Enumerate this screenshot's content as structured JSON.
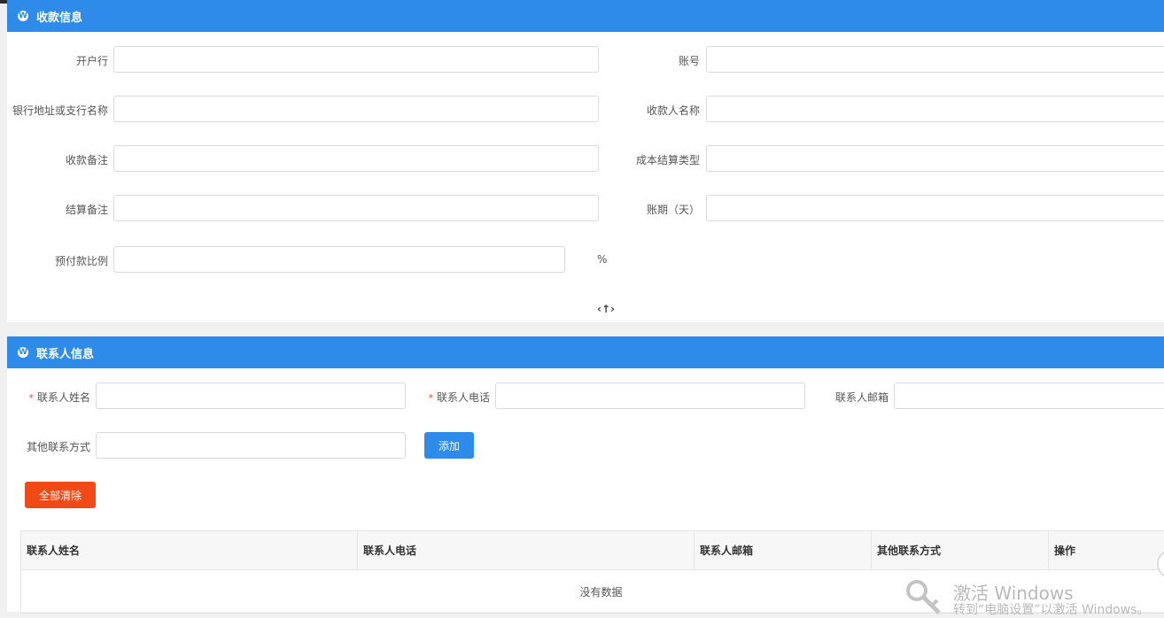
{
  "payment_section": {
    "title": "收款信息",
    "bank_label": "开户行",
    "account_label": "账号",
    "bank_address_label": "银行地址或支行名称",
    "payee_label": "收款人名称",
    "payment_note_label": "收款备注",
    "cost_type_label": "成本结算类型",
    "settlement_note_label": "结算备注",
    "period_label": "账期（天）",
    "prepay_label": "预付款比例",
    "prepay_unit": "%",
    "collapse_toggle": "‹↑›"
  },
  "contact_section": {
    "title": "联系人信息",
    "name_label": "联系人姓名",
    "phone_label": "联系人电话",
    "email_label": "联系人邮箱",
    "other_label": "其他联系方式",
    "required_mark": "*",
    "add_button": "添加",
    "clear_button": "全部清除"
  },
  "contact_table": {
    "columns": [
      "联系人姓名",
      "联系人电话",
      "联系人邮箱",
      "其他联系方式",
      "操作"
    ],
    "empty_text": "没有数据"
  },
  "watermark": {
    "title": "激活 Windows",
    "subtitle": "转到“电脑设置”以激活 Windows。"
  },
  "colors": {
    "header_blue": "#2f8be9",
    "danger_red": "#f24a16"
  }
}
